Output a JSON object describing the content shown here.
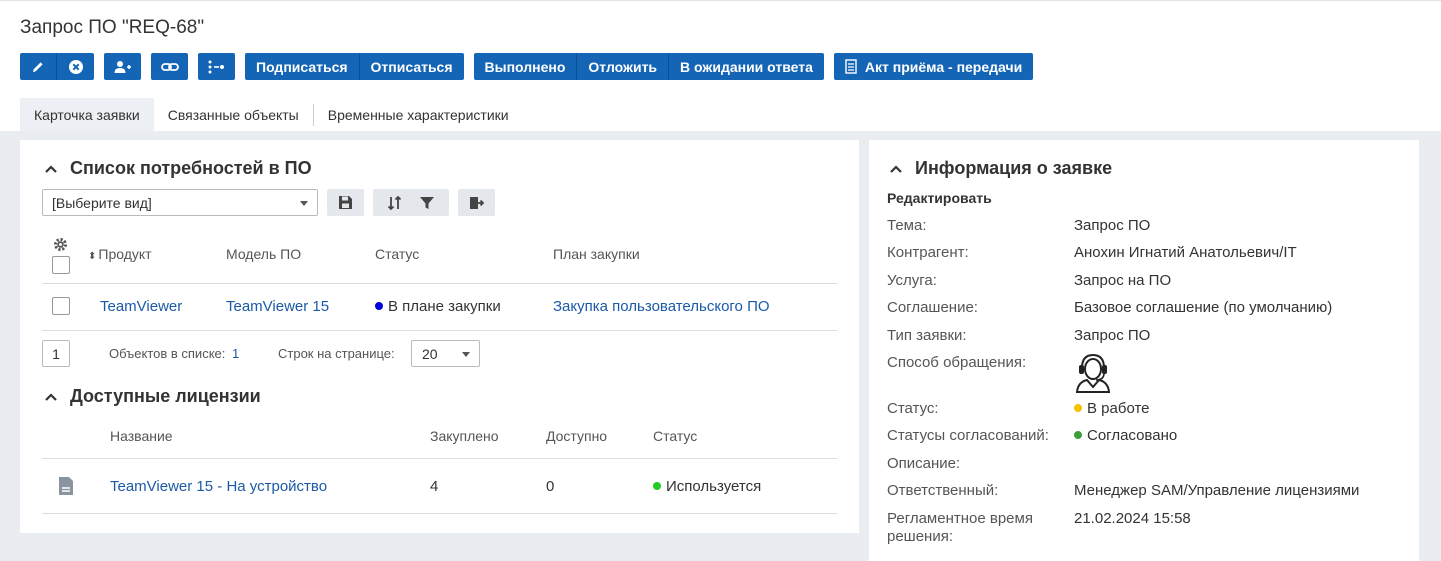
{
  "page": {
    "title": "Запрос ПО \"REQ-68\""
  },
  "toolbar": {
    "subscribe": "Подписаться",
    "unsubscribe": "Отписаться",
    "done": "Выполнено",
    "postpone": "Отложить",
    "awaiting": "В ожидании ответа",
    "act": "Акт приёма - передачи",
    "icons": [
      "pencil-icon",
      "cancel-icon",
      "add-user-icon",
      "link-icon",
      "workflow-icon",
      "document-icon"
    ]
  },
  "tabs": [
    "Карточка заявки",
    "Связанные объекты",
    "Временные характеристики"
  ],
  "needs": {
    "title": "Список потребностей в ПО",
    "view_select": "[Выберите вид]",
    "columns": {
      "product": "Продукт",
      "model": "Модель ПО",
      "status": "Статус",
      "plan": "План закупки"
    },
    "rows": [
      {
        "product": "TeamViewer",
        "model": "TeamViewer 15",
        "status": "В плане закупки",
        "status_color": "#0000e0",
        "plan": "Закупка пользовательского ПО"
      }
    ],
    "pager": {
      "page": "1",
      "count_label": "Объектов в списке:",
      "count": "1",
      "rows_label": "Строк на странице:",
      "rows_value": "20"
    }
  },
  "licenses": {
    "title": "Доступные лицензии",
    "columns": {
      "name": "Название",
      "bought": "Закуплено",
      "available": "Доступно",
      "status": "Статус"
    },
    "rows": [
      {
        "name": "TeamViewer 15 - На устройство",
        "bought": "4",
        "available": "0",
        "status": "Используется",
        "status_color": "#22cc22"
      }
    ]
  },
  "info": {
    "title": "Информация о заявке",
    "edit": "Редактировать",
    "fields": {
      "topic_label": "Тема:",
      "topic": "Запрос ПО",
      "contractor_label": "Контрагент:",
      "contractor": "Анохин Игнатий Анатольевич/IT",
      "service_label": "Услуга:",
      "service": "Запрос на ПО",
      "agreement_label": "Соглашение:",
      "agreement": "Базовое соглашение (по умолчанию)",
      "type_label": "Тип заявки:",
      "type": "Запрос ПО",
      "channel_label": "Способ обращения:",
      "status_label": "Статус:",
      "status": "В работе",
      "status_color": "#f2c200",
      "approval_label": "Статусы согласований:",
      "approval": "Согласовано",
      "approval_color": "#3aa03a",
      "description_label": "Описание:",
      "responsible_label": "Ответственный:",
      "responsible": "Менеджер SAM/Управление лицензиями",
      "deadline_label_1": "Регламентное время",
      "deadline_label_2": "решения:",
      "deadline": "21.02.2024 15:58"
    }
  },
  "colors": {
    "accent": "#1565b7",
    "link": "#1a5aa6",
    "bg": "#e9edf2"
  }
}
